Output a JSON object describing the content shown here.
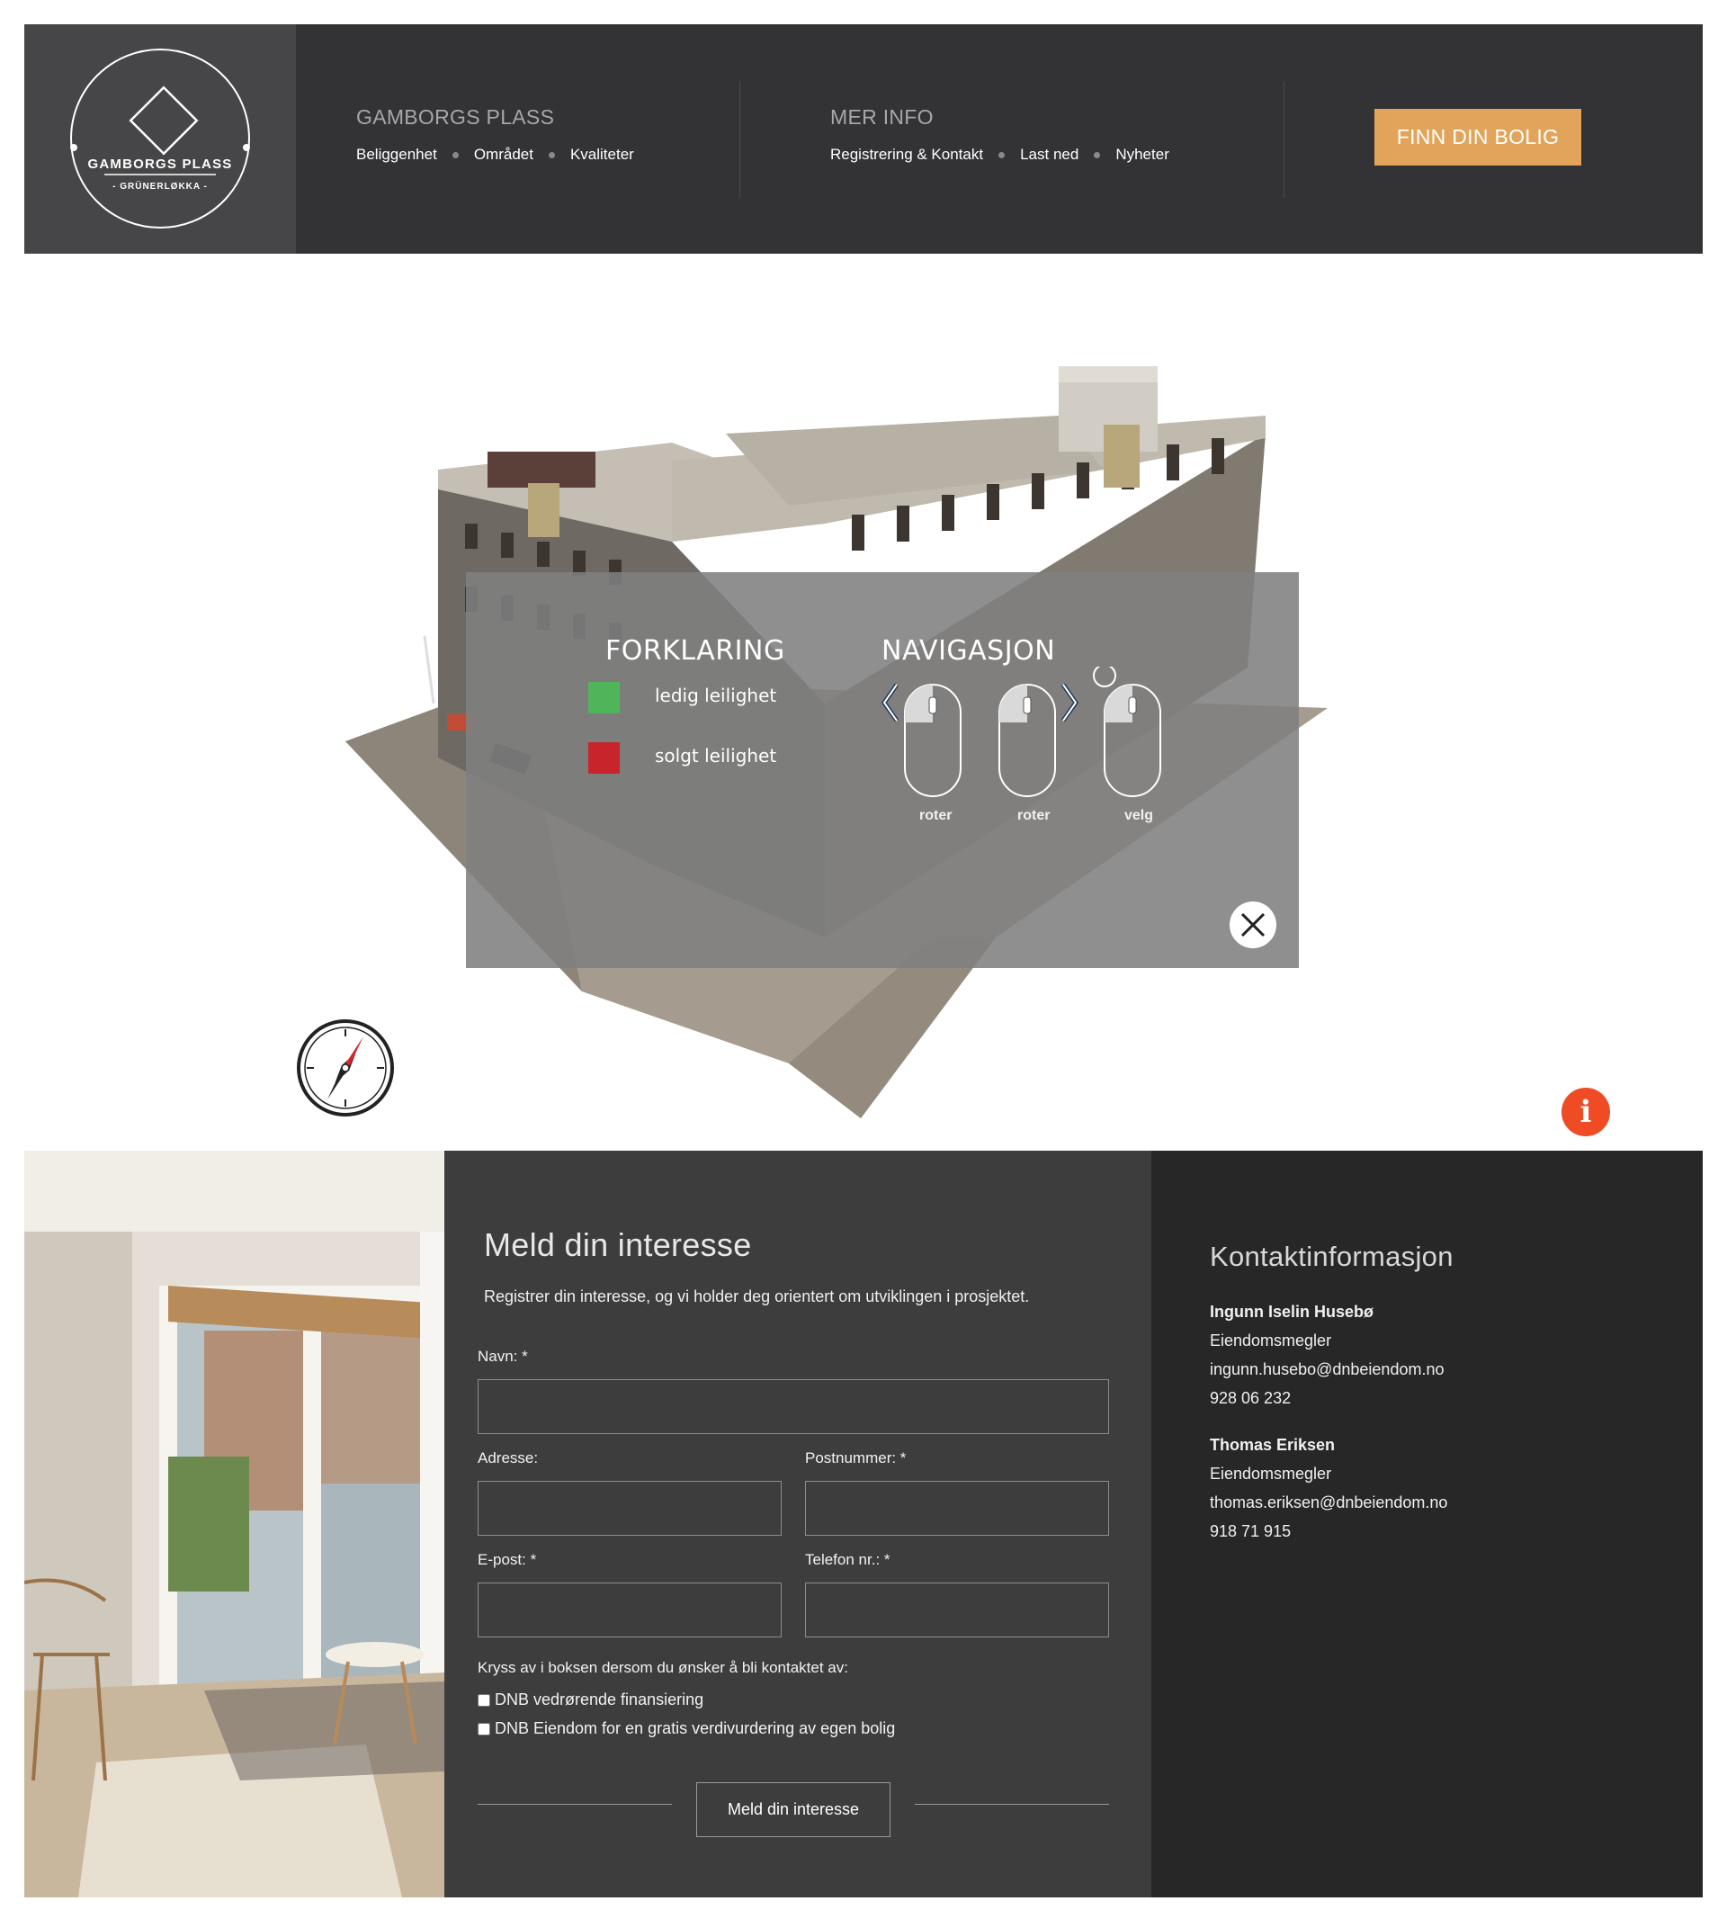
{
  "header": {
    "logo": {
      "title": "GAMBORGS PLASS",
      "subtitle": "- GRÜNERLØKKA -"
    },
    "groups": [
      {
        "title": "GAMBORGS PLASS",
        "links": [
          "Beliggenhet",
          "Området",
          "Kvaliteter"
        ]
      },
      {
        "title": "MER INFO",
        "links": [
          "Registrering & Kontakt",
          "Last ned",
          "Nyheter"
        ]
      }
    ],
    "cta_label": "FINN DIN BOLIG",
    "cta_color": "#e2a45a"
  },
  "viewer": {
    "legend_title": "FORKLARING",
    "legend_items": [
      {
        "label": "ledig leilighet",
        "color": "#4fb45a"
      },
      {
        "label": "solgt leilighet",
        "color": "#c8242b"
      }
    ],
    "nav_title": "NAVIGASJON",
    "nav_items": [
      "roter",
      "roter",
      "velg"
    ],
    "info_label": "i",
    "info_color": "#ef4b24"
  },
  "form": {
    "title": "Meld din interesse",
    "intro": "Registrer din interesse, og vi holder deg orientert om utviklingen i prosjektet.",
    "fields": {
      "name": "Navn: *",
      "address": "Adresse:",
      "postal": "Postnummer: *",
      "email": "E-post: *",
      "phone": "Telefon nr.: *"
    },
    "checkbox_intro": "Kryss av i boksen dersom du ønsker å bli kontaktet av:",
    "checkboxes": [
      "DNB vedrørende finansiering",
      "DNB Eiendom for en gratis verdivurdering av egen bolig"
    ],
    "submit": "Meld din interesse"
  },
  "contact": {
    "title": "Kontaktinformasjon",
    "people": [
      {
        "name": "Ingunn Iselin Husebø",
        "role": "Eiendomsmegler",
        "email": "ingunn.husebo@dnbeiendom.no",
        "phone": "928 06 232"
      },
      {
        "name": "Thomas Eriksen",
        "role": "Eiendomsmegler",
        "email": "thomas.eriksen@dnbeiendom.no",
        "phone": "918 71 915"
      }
    ]
  }
}
